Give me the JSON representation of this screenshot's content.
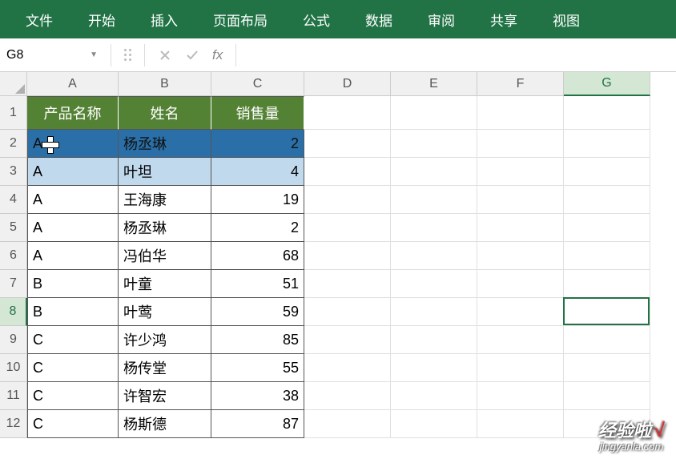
{
  "menu": [
    "文件",
    "开始",
    "插入",
    "页面布局",
    "公式",
    "数据",
    "审阅",
    "共享",
    "视图"
  ],
  "name_box": "G8",
  "fx_label": "fx",
  "formula_value": "",
  "col_widths": {
    "A": 114,
    "B": 116,
    "C": 116,
    "D": 108,
    "E": 108,
    "F": 108,
    "G": 108
  },
  "columns": [
    "A",
    "B",
    "C",
    "D",
    "E",
    "F",
    "G"
  ],
  "active_col": "G",
  "active_row": 8,
  "header_row": 1,
  "headers": [
    "产品名称",
    "姓名",
    "销售量"
  ],
  "data_rows": [
    {
      "n": 2,
      "a": "A",
      "b": "杨丞琳",
      "c": "2",
      "highlight": "dark",
      "cursor": true
    },
    {
      "n": 3,
      "a": "A",
      "b": "叶坦",
      "c": "4",
      "highlight": "light"
    },
    {
      "n": 4,
      "a": "A",
      "b": "王海康",
      "c": "19"
    },
    {
      "n": 5,
      "a": "A",
      "b": "杨丞琳",
      "c": "2"
    },
    {
      "n": 6,
      "a": "A",
      "b": "冯伯华",
      "c": "68"
    },
    {
      "n": 7,
      "a": "B",
      "b": "叶童",
      "c": "51"
    },
    {
      "n": 8,
      "a": "B",
      "b": "叶莺",
      "c": "59"
    },
    {
      "n": 9,
      "a": "C",
      "b": "许少鸿",
      "c": "85"
    },
    {
      "n": 10,
      "a": "C",
      "b": "杨传堂",
      "c": "55"
    },
    {
      "n": 11,
      "a": "C",
      "b": "许智宏",
      "c": "38"
    },
    {
      "n": 12,
      "a": "C",
      "b": "杨斯德",
      "c": "87"
    }
  ],
  "watermark": {
    "top": "经验啦",
    "check": "√",
    "bottom": "jingyanla.com"
  }
}
